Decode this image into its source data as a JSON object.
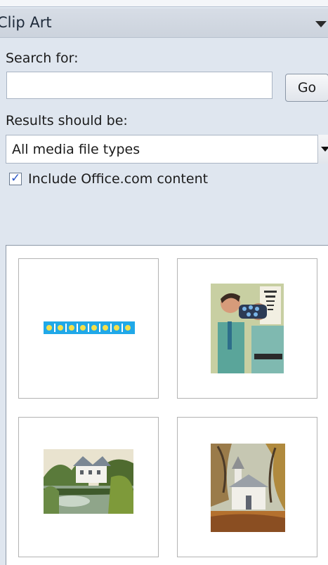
{
  "pane": {
    "title": "Clip Art",
    "menu_icon": "dropdown-triangle-icon"
  },
  "search": {
    "label": "Search for:",
    "value": "",
    "go_label": "Go"
  },
  "results_filter": {
    "label": "Results should be:",
    "selected": "All media file types"
  },
  "include_office": {
    "label": "Include Office.com content",
    "checked": true
  },
  "results": [
    {
      "name": "clip-dotted-border"
    },
    {
      "name": "clip-eye-exam"
    },
    {
      "name": "clip-lakeside-house"
    },
    {
      "name": "clip-country-church"
    }
  ],
  "colors": {
    "pane_bg": "#dfe6ef",
    "accent_check": "#2a56c6"
  }
}
